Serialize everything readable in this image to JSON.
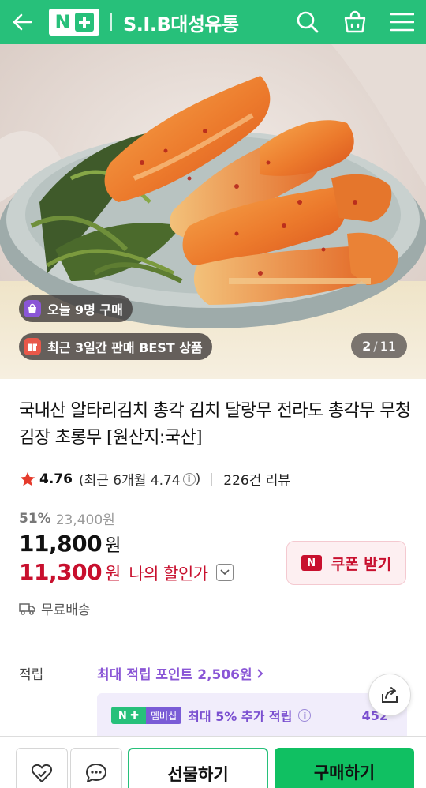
{
  "header": {
    "store_name": "S.I.B대성유통",
    "brand_accent": "#27c07a"
  },
  "hero": {
    "badge_today": "오늘 9명 구매",
    "badge_best": "최근 3일간 판매 BEST 상품",
    "pager_current": "2",
    "pager_total": "11"
  },
  "product": {
    "title": "국내산 알타리김치 총각 김치 달랑무 전라도 총각무 무청 김장 초롱무 [원산지:국산]",
    "rating": "4.76",
    "rating_recent": "(최근 6개월 4.74",
    "rating_recent_close": ")",
    "review_count": "226건 리뷰",
    "discount_rate": "51%",
    "original_price": "23,400원",
    "price": "11,800",
    "price_unit": "원",
    "my_price": "11,300",
    "my_price_unit": "원",
    "my_price_label": "나의 할인가",
    "coupon_label": "쿠폰 받기",
    "shipping": "무료배송"
  },
  "points": {
    "label": "적립",
    "max_points": "최대 적립 포인트 2,506원",
    "member_badge": "멤버십",
    "member_text": "최대 5% 추가 적립",
    "member_value": "452"
  },
  "bottom": {
    "gift_label": "선물하기",
    "buy_label": "구매하기"
  },
  "colors": {
    "accent": "#27c07a",
    "sale_red": "#c8102e",
    "purple": "#8a56d6"
  }
}
